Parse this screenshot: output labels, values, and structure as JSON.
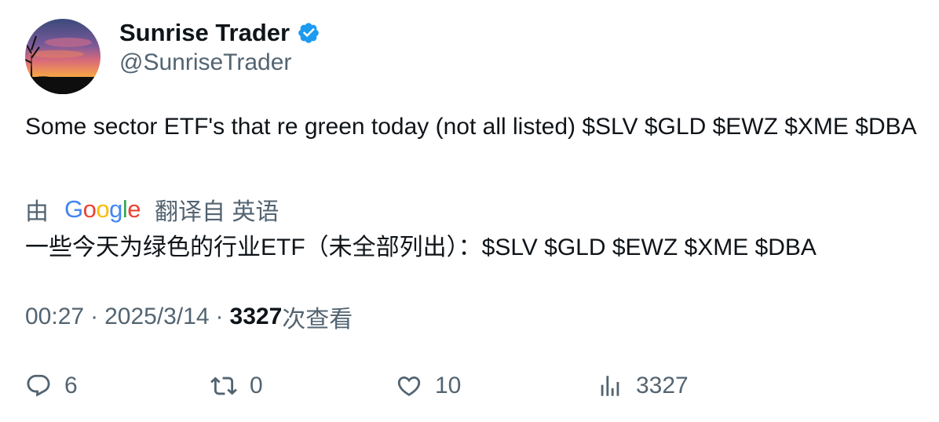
{
  "author": {
    "display_name": "Sunrise Trader",
    "handle": "@SunriseTrader",
    "verified_color": "#1d9bf0"
  },
  "tweet": {
    "text": "Some sector ETF's that re green today (not all listed) $SLV $GLD $EWZ $XME $DBA"
  },
  "translation": {
    "prefix": "由",
    "provider_letters": [
      "G",
      "o",
      "o",
      "g",
      "l",
      "e"
    ],
    "suffix": "翻译自 英语",
    "text": "一些今天为绿色的行业ETF（未全部列出）：$SLV $GLD $EWZ $XME $DBA"
  },
  "meta": {
    "time": "00:27",
    "separator": "·",
    "date": "2025/3/14",
    "views_count": "3327",
    "views_label": "次查看"
  },
  "actions": {
    "reply_count": "6",
    "retweet_count": "0",
    "like_count": "10",
    "views_count": "3327"
  },
  "icons": {
    "reply": "reply-icon",
    "retweet": "retweet-icon",
    "like": "heart-icon",
    "views": "analytics-icon",
    "verified": "verified-badge-icon"
  }
}
